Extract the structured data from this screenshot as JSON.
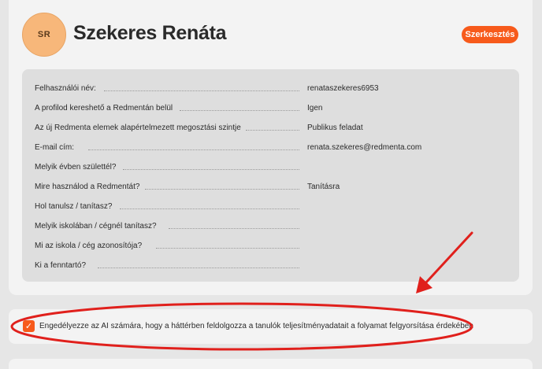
{
  "profile": {
    "initials": "SR",
    "name": "Szekeres Renáta",
    "edit_label": "Szerkesztés"
  },
  "details": [
    {
      "label": "Felhasználói név:",
      "value": "renataszekeres6953"
    },
    {
      "label": "A profilod kereshető a Redmentán belül",
      "value": "Igen"
    },
    {
      "label": "Az új Redmenta elemek alapértelmezett megosztási szintje",
      "value": "Publikus feladat"
    },
    {
      "label": "E-mail cím:",
      "value": "renata.szekeres@redmenta.com"
    },
    {
      "label": "Melyik évben születtél?",
      "value": ""
    },
    {
      "label": "Mire használod a Redmentát?",
      "value": "Tanításra"
    },
    {
      "label": "Hol tanulsz / tanítasz?",
      "value": ""
    },
    {
      "label": "Melyik iskolában / cégnél tanítasz?",
      "value": ""
    },
    {
      "label": "Mi az iskola / cég azonosítója?",
      "value": ""
    },
    {
      "label": "Ki a fenntartó?",
      "value": ""
    }
  ],
  "ai_consent": {
    "checked": true,
    "check_glyph": "✓",
    "label": "Engedélyezze az AI számára, hogy a háttérben feldolgozza a tanulók teljesítményadatait a folyamat felgyorsítása érdekében"
  },
  "annotation": {
    "color": "#e0201c",
    "shapes": [
      "red-arrow",
      "red-ellipse"
    ]
  }
}
